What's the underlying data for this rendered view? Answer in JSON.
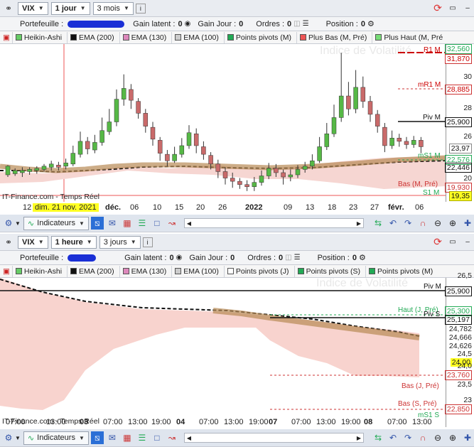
{
  "top": {
    "symbol": "VIX",
    "interval": "1 jour",
    "range": "3 mois",
    "portfolio_label": "Portefeuille :",
    "latent_label": "Gain latent :",
    "latent_value": "0",
    "day_label": "Gain Jour :",
    "day_value": "0",
    "orders_label": "Ordres :",
    "orders_value": "0",
    "position_label": "Position :",
    "position_value": "0",
    "indicators": [
      "Heikin-Ashi",
      "EMA (200)",
      "EMA (130)",
      "EMA (100)",
      "Points pivots (M)",
      "Plus Bas (M, Pré)",
      "Plus Haut (M, Pré"
    ],
    "watermark": "Indice de Volatilité",
    "prices": [
      "32,560",
      "31,870",
      "30",
      "28,885",
      "28",
      "26",
      "25,900",
      "23,97",
      "22,576",
      "22,446",
      "20",
      "19,930",
      "19,35"
    ],
    "pivot_labels": [
      "R1 M",
      "mR1 M",
      "Piv M",
      "mS1 M",
      "Bas (M, Pré)",
      "S1 M"
    ],
    "source": "IT-Finance.com - Temps Réel",
    "dates": [
      "12",
      "dim. 21 nov. 2021",
      "déc.",
      "06",
      "10",
      "15",
      "20",
      "26",
      "2022",
      "09",
      "13",
      "18",
      "23",
      "27",
      "févr.",
      "06"
    ],
    "candles": [
      [
        30,
        21.5,
        22.3,
        21.3,
        22.4
      ],
      [
        30,
        21.6,
        21.9,
        21.4,
        22.1
      ],
      [
        30,
        21.7,
        21.9,
        21.3,
        22.2
      ],
      [
        30,
        21.8,
        22,
        21.5,
        22.2
      ],
      [
        30,
        21.9,
        22.1,
        21.6,
        22.3
      ],
      [
        30,
        22,
        22.3,
        21.8,
        22.5
      ],
      [
        30,
        22.2,
        22.5,
        21.9,
        22.8
      ],
      [
        30,
        22.4,
        22.2,
        21.9,
        22.7
      ],
      [
        30,
        22.3,
        22.6,
        22,
        23
      ],
      [
        30,
        22.5,
        23.5,
        22.3,
        24.2
      ],
      [
        30,
        23.4,
        24.6,
        23.1,
        25.5
      ],
      [
        30,
        24.6,
        23.9,
        23.4,
        25
      ],
      [
        30,
        23.8,
        24.5,
        23.5,
        25.2
      ],
      [
        30,
        24.5,
        25.6,
        24.2,
        26.8
      ],
      [
        30,
        25.5,
        26.4,
        25.2,
        27.6
      ],
      [
        30,
        26.4,
        28.5,
        26,
        29.4
      ],
      [
        30,
        28.5,
        29.5,
        27.9,
        30.8
      ],
      [
        30,
        29.4,
        28.4,
        27.6,
        29.9
      ],
      [
        30,
        28.3,
        27.2,
        26.7,
        28.6
      ],
      [
        30,
        27.2,
        26,
        25.4,
        27.6
      ],
      [
        30,
        25.9,
        24.8,
        24.2,
        26.4
      ],
      [
        30,
        24.7,
        23.5,
        22.8,
        25
      ],
      [
        30,
        23.4,
        22.8,
        22.3,
        23.8
      ],
      [
        30,
        22.8,
        23.4,
        22.6,
        24.1
      ],
      [
        30,
        23.4,
        24.2,
        23.1,
        24.9
      ],
      [
        30,
        24.2,
        25.4,
        23.9,
        26.1
      ],
      [
        30,
        25.3,
        24.2,
        23.5,
        25.8
      ],
      [
        30,
        24.1,
        23.4,
        22.9,
        24.6
      ],
      [
        30,
        23.3,
        22.5,
        22,
        23.6
      ],
      [
        30,
        22.5,
        21.8,
        21.2,
        22.9
      ],
      [
        30,
        21.8,
        21.2,
        20.6,
        22.2
      ],
      [
        30,
        21.2,
        20.9,
        20.3,
        21.7
      ],
      [
        30,
        20.9,
        20.6,
        20.2,
        21.2
      ],
      [
        30,
        20.6,
        20.4,
        20,
        21
      ],
      [
        30,
        20.4,
        20.8,
        20,
        21.3
      ],
      [
        30,
        20.8,
        21.4,
        20.5,
        21.9
      ],
      [
        30,
        21.4,
        22.1,
        21.1,
        22.6
      ],
      [
        30,
        22.1,
        21.7,
        21.3,
        22.5
      ],
      [
        30,
        21.7,
        21.3,
        20.6,
        22
      ],
      [
        30,
        21.3,
        21.5,
        20.9,
        22
      ],
      [
        30,
        21.5,
        22,
        21.2,
        22.4
      ],
      [
        30,
        22,
        22.3,
        21.7,
        22.7
      ],
      [
        30,
        22.3,
        22.8,
        22,
        23.4
      ],
      [
        30,
        22.8,
        24.1,
        22.6,
        25
      ],
      [
        30,
        24.1,
        25.3,
        23.8,
        26.3
      ],
      [
        30,
        25.3,
        26.8,
        25,
        28
      ],
      [
        30,
        26.8,
        28.8,
        26.4,
        32.8
      ],
      [
        30,
        28.8,
        27.6,
        27,
        30.1
      ],
      [
        30,
        27.6,
        29.6,
        27.2,
        31.2
      ],
      [
        30,
        29.6,
        28.3,
        27.7,
        30.6
      ],
      [
        30,
        28.3,
        27.1,
        26.4,
        28.8
      ],
      [
        30,
        27.1,
        26,
        25.4,
        27.5
      ],
      [
        30,
        25.9,
        24.2,
        23.6,
        26.3
      ],
      [
        30,
        24.2,
        24.9,
        23.9,
        25.6
      ],
      [
        30,
        24.9,
        24.6,
        24.1,
        25.3
      ],
      [
        30,
        24.6,
        24.3,
        23.9,
        25
      ],
      [
        30,
        24.3,
        24.7,
        24,
        25.1
      ],
      [
        30,
        24.7,
        24.1,
        23.5,
        25
      ]
    ]
  },
  "bottom": {
    "symbol": "VIX",
    "interval": "1 heure",
    "range": "3 jours",
    "portfolio_label": "Portefeuille :",
    "latent_label": "Gain latent :",
    "latent_value": "0",
    "day_label": "Gain Jour :",
    "day_value": "0",
    "orders_label": "Ordres :",
    "orders_value": "0",
    "position_label": "Position :",
    "position_value": "0",
    "indicators": [
      "Heikin-Ashi",
      "EMA (200)",
      "EMA (130)",
      "EMA (100)",
      "Points pivots (J)",
      "Points pivots (S)",
      "Points pivots (M)"
    ],
    "watermark": "Indice de Volatilité",
    "prices": [
      "26,5",
      "25,900",
      "25,300",
      "25,197",
      "24,782",
      "24,666",
      "24,626",
      "24,5",
      "24,00",
      "24,0",
      "23,760",
      "23,5",
      "23",
      "22,850"
    ],
    "pivot_labels": [
      "Piv M",
      "Haut (J, Pré)",
      "Piv S",
      "Bas (J, Pré)",
      "Bas (S, Pré)",
      "mS1 S"
    ],
    "source": "IT-Finance.com - Temps Réel",
    "dates": [
      "07:00",
      "13:00",
      "03",
      "07:00",
      "13:00",
      "19:00",
      "04",
      "07:00",
      "13:00",
      "19:00",
      "07",
      "07:00",
      "13:00",
      "19:00",
      "08",
      "07:00",
      "13:00"
    ]
  },
  "toolbar": {
    "indicators_label": "Indicateurs"
  }
}
